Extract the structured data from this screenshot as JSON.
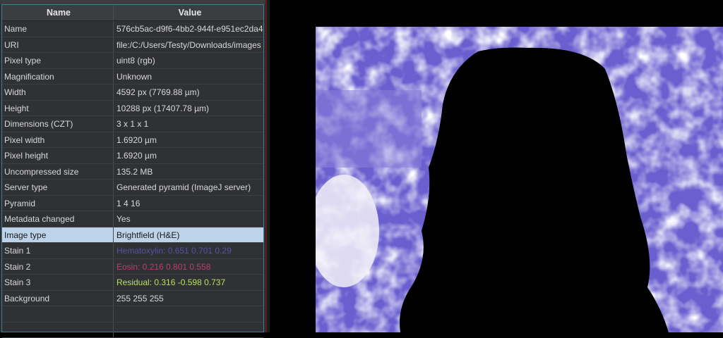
{
  "table": {
    "headers": {
      "name": "Name",
      "value": "Value"
    },
    "rows": [
      {
        "name": "Name",
        "value": "576cb5ac-d9f6-4bb2-944f-e951ec2da4..."
      },
      {
        "name": "URI",
        "value": "file:/C:/Users/Testy/Downloads/images ..."
      },
      {
        "name": "Pixel type",
        "value": "uint8 (rgb)"
      },
      {
        "name": "Magnification",
        "value": "Unknown"
      },
      {
        "name": "Width",
        "value": "4592 px (7769.88 µm)"
      },
      {
        "name": "Height",
        "value": "10288 px (17407.78 µm)"
      },
      {
        "name": "Dimensions (CZT)",
        "value": "3 x 1 x 1"
      },
      {
        "name": "Pixel width",
        "value": "1.6920 µm"
      },
      {
        "name": "Pixel height",
        "value": "1.6920 µm"
      },
      {
        "name": "Uncompressed size",
        "value": "135.2 MB"
      },
      {
        "name": "Server type",
        "value": "Generated pyramid (ImageJ server)"
      },
      {
        "name": "Pyramid",
        "value": "1 4 16"
      },
      {
        "name": "Metadata changed",
        "value": "Yes"
      },
      {
        "name": "Image type",
        "value": "Brightfield (H&E)"
      },
      {
        "name": "Stain 1",
        "value": "Hematoxylin: 0.651 0.701 0.29",
        "color": "#5a4fa8"
      },
      {
        "name": "Stain 2",
        "value": "Eosin: 0.216 0.801 0.558",
        "color": "#b8406a"
      },
      {
        "name": "Stain 3",
        "value": "Residual: 0.316 -0.598 0.737",
        "color": "#b8e060"
      },
      {
        "name": "Background",
        "value": "255 255 255"
      },
      {
        "name": "",
        "value": ""
      },
      {
        "name": "",
        "value": ""
      }
    ],
    "selected_row": "Image type"
  }
}
